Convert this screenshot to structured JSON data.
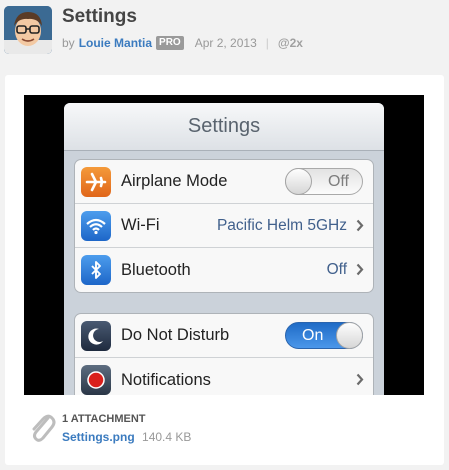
{
  "shot": {
    "title": "Settings",
    "by": "by",
    "author": "Louie Mantia",
    "badge": "PRO",
    "date": "Apr 2, 2013",
    "separator": "|",
    "resolution": "@2x"
  },
  "ios_screen": {
    "nav_title": "Settings",
    "group1": [
      {
        "icon": "airplane-icon",
        "label": "Airplane Mode",
        "control": "toggle",
        "toggle_text": "Off",
        "state": "off"
      },
      {
        "icon": "wifi-icon",
        "label": "Wi-Fi",
        "value": "Pacific Helm 5GHz"
      },
      {
        "icon": "bluetooth-icon",
        "label": "Bluetooth",
        "value": "Off"
      }
    ],
    "group2": [
      {
        "icon": "moon-icon",
        "label": "Do Not Disturb",
        "control": "toggle",
        "toggle_text": "On",
        "state": "on"
      },
      {
        "icon": "notifications-icon",
        "label": "Notifications"
      }
    ]
  },
  "attachment": {
    "title": "1 ATTACHMENT",
    "filename": "Settings.png",
    "size": "140.4 KB"
  },
  "colors": {
    "link": "#3b7bbf",
    "toggle_on": "#2f80dc",
    "ios_value": "#41608c"
  }
}
